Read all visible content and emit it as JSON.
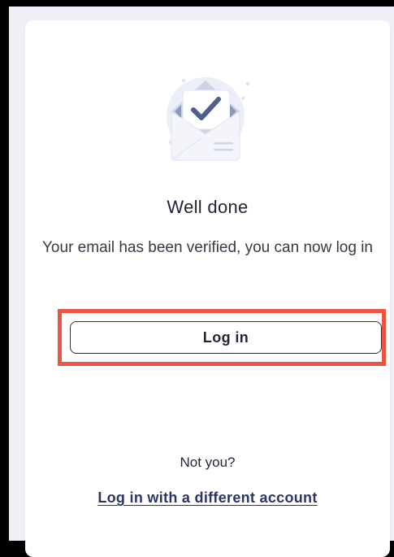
{
  "card": {
    "heading": "Well done",
    "message": "Your email has been verified, you can now log in",
    "login_button": "Log in",
    "not_you": "Not you?",
    "different_account_link": "Log in with a different account"
  },
  "illustration": {
    "icon": "envelope-checkmark-icon"
  },
  "colors": {
    "highlight_border": "#ea5545",
    "link": "#2a3566",
    "background": "#eef0f5"
  }
}
